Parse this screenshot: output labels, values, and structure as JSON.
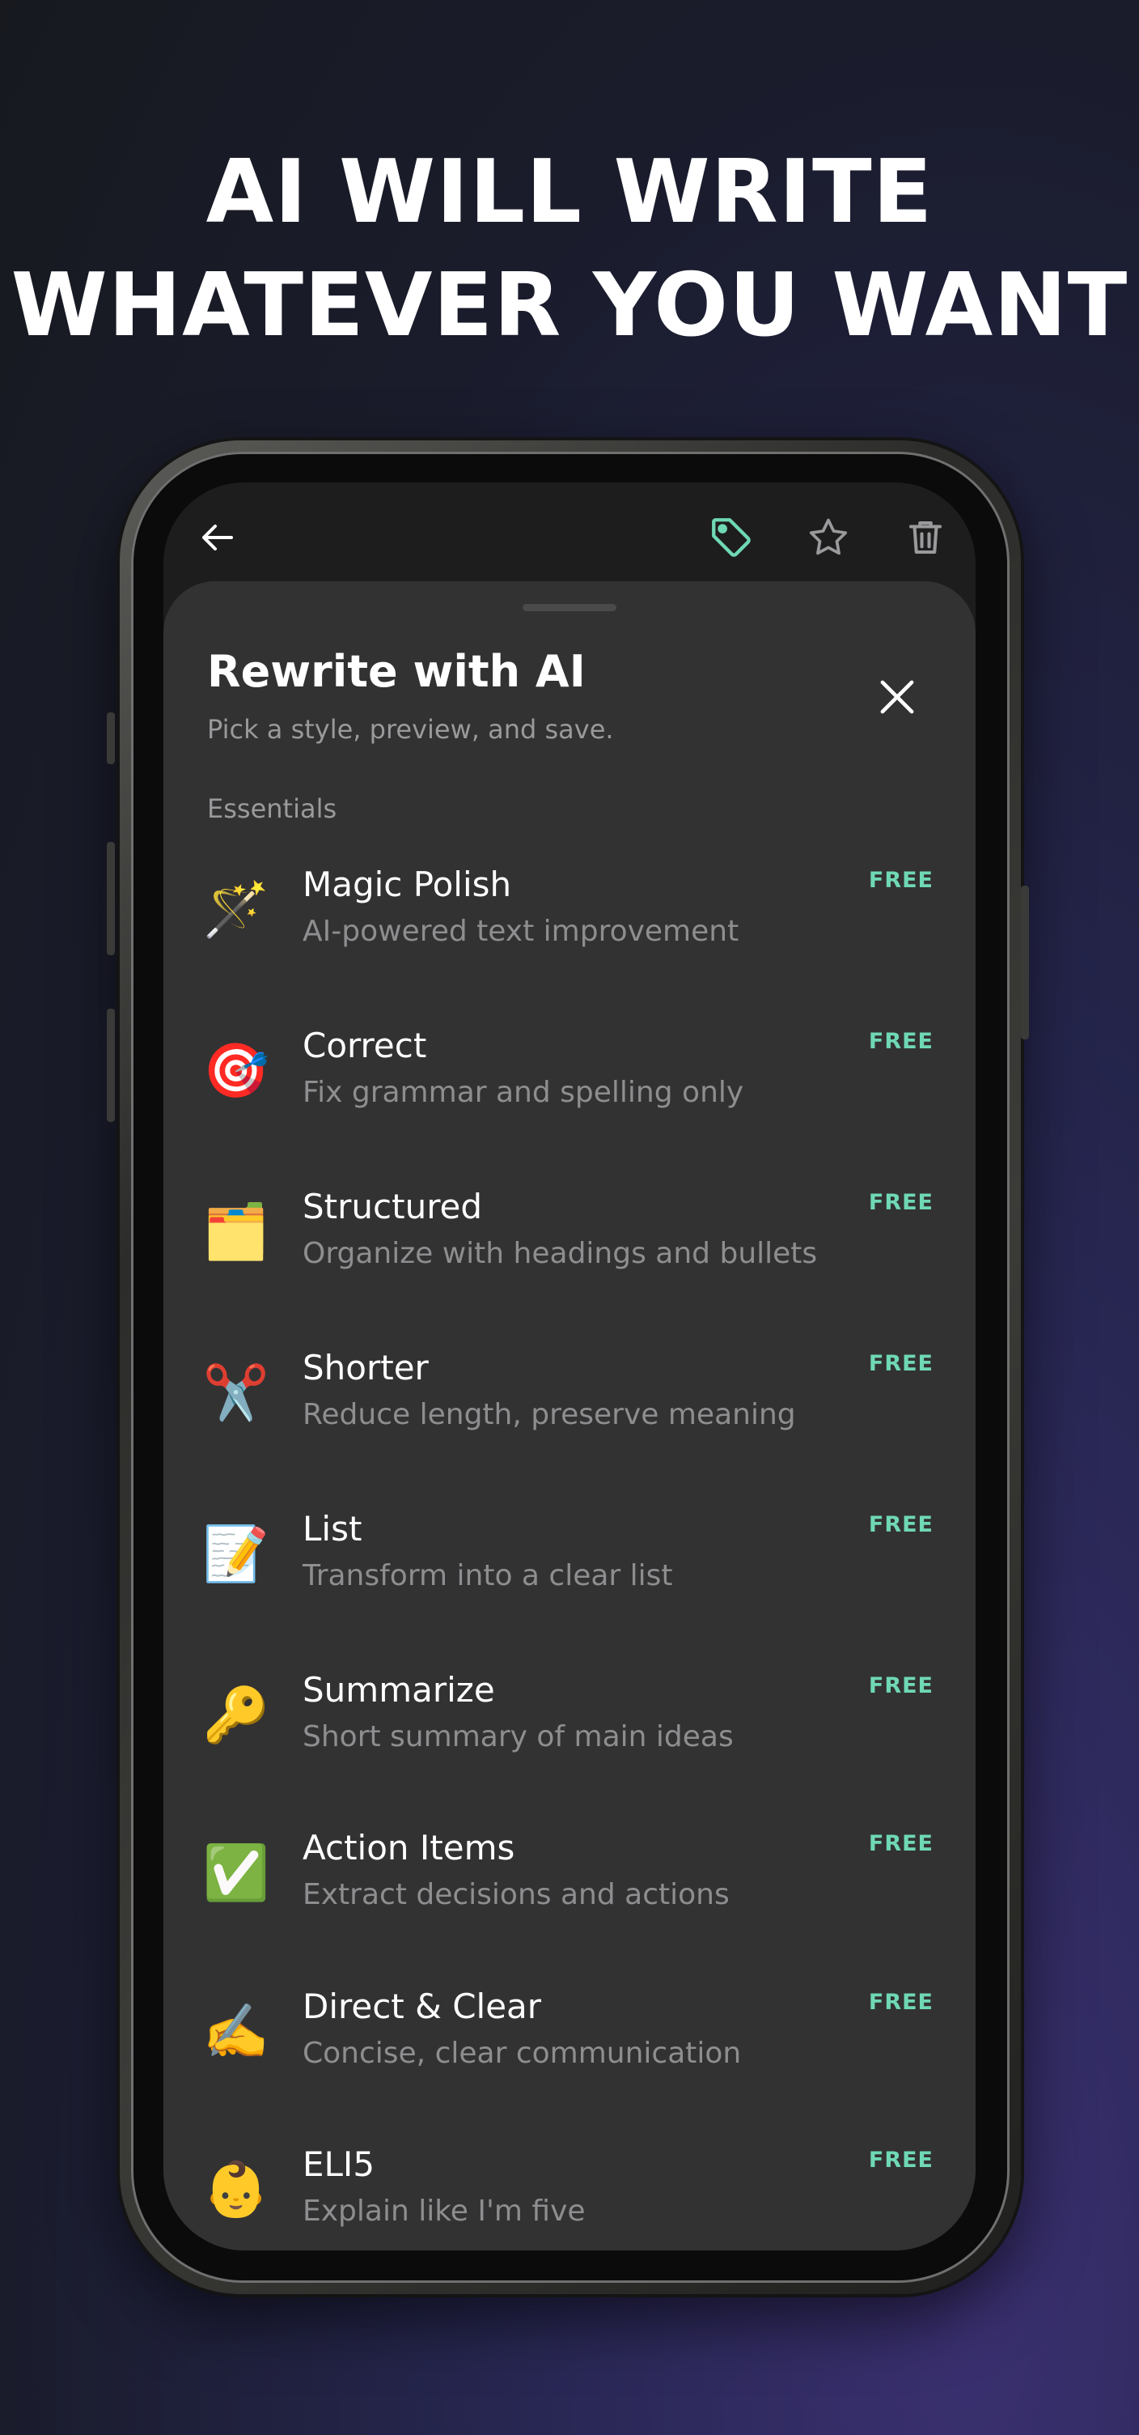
{
  "headline": {
    "line1": "AI WILL WRITE",
    "line2": "WHATEVER YOU WANT"
  },
  "toolbar": {
    "back_icon": "arrow-left-icon",
    "tag_icon": "tag-icon",
    "star_icon": "star-icon",
    "trash_icon": "trash-icon",
    "accent_color": "#6fd8b4"
  },
  "sheet": {
    "title": "Rewrite with AI",
    "subtitle": "Pick a style, preview, and save.",
    "close_icon": "close-icon",
    "section_label": "Essentials"
  },
  "styles": [
    {
      "emoji": "🪄",
      "icon": "magic-wand-icon",
      "title": "Magic Polish",
      "desc": "AI-powered text improvement",
      "badge": "FREE"
    },
    {
      "emoji": "🎯",
      "icon": "target-icon",
      "title": "Correct",
      "desc": "Fix grammar and spelling only",
      "badge": "FREE"
    },
    {
      "emoji": "🗂️",
      "icon": "folder-icon",
      "title": "Structured",
      "desc": "Organize with headings and bullets",
      "badge": "FREE"
    },
    {
      "emoji": "✂️",
      "icon": "scissors-icon",
      "title": "Shorter",
      "desc": "Reduce length, preserve meaning",
      "badge": "FREE"
    },
    {
      "emoji": "📝",
      "icon": "memo-icon",
      "title": "List",
      "desc": "Transform into a clear list",
      "badge": "FREE"
    },
    {
      "emoji": "🔑",
      "icon": "key-icon",
      "title": "Summarize",
      "desc": "Short summary of main ideas",
      "badge": "FREE"
    },
    {
      "emoji": "✅",
      "icon": "check-box-icon",
      "title": "Action Items",
      "desc": "Extract decisions and actions",
      "badge": "FREE"
    },
    {
      "emoji": "✍️",
      "icon": "writing-hand-icon",
      "title": "Direct & Clear",
      "desc": "Concise, clear communication",
      "badge": "FREE"
    },
    {
      "emoji": "👶",
      "icon": "baby-icon",
      "title": "ELI5",
      "desc": "Explain like I'm five",
      "badge": "FREE"
    }
  ]
}
